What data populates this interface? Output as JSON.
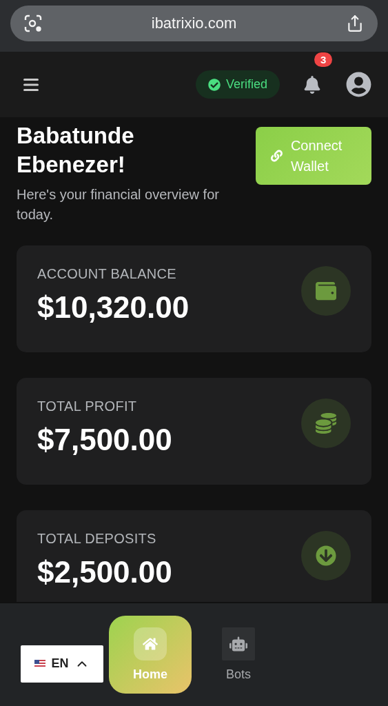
{
  "browser": {
    "url": "ibatrixio.com"
  },
  "header": {
    "badge": "Verified",
    "notifications": "3"
  },
  "greeting": {
    "name": "Babatunde Ebenezer!",
    "subtitle": "Here's your financial overview for today.",
    "button": "Connect Wallet"
  },
  "cards": [
    {
      "label": "ACCOUNT BALANCE",
      "value": "$10,320.00"
    },
    {
      "label": "TOTAL PROFIT",
      "value": "$7,500.00"
    },
    {
      "label": "TOTAL DEPOSITS",
      "value": "$2,500.00"
    }
  ],
  "language": {
    "code": "EN"
  },
  "nav": [
    {
      "label": "Home",
      "selected": true
    },
    {
      "label": "Bots",
      "selected": false
    }
  ]
}
